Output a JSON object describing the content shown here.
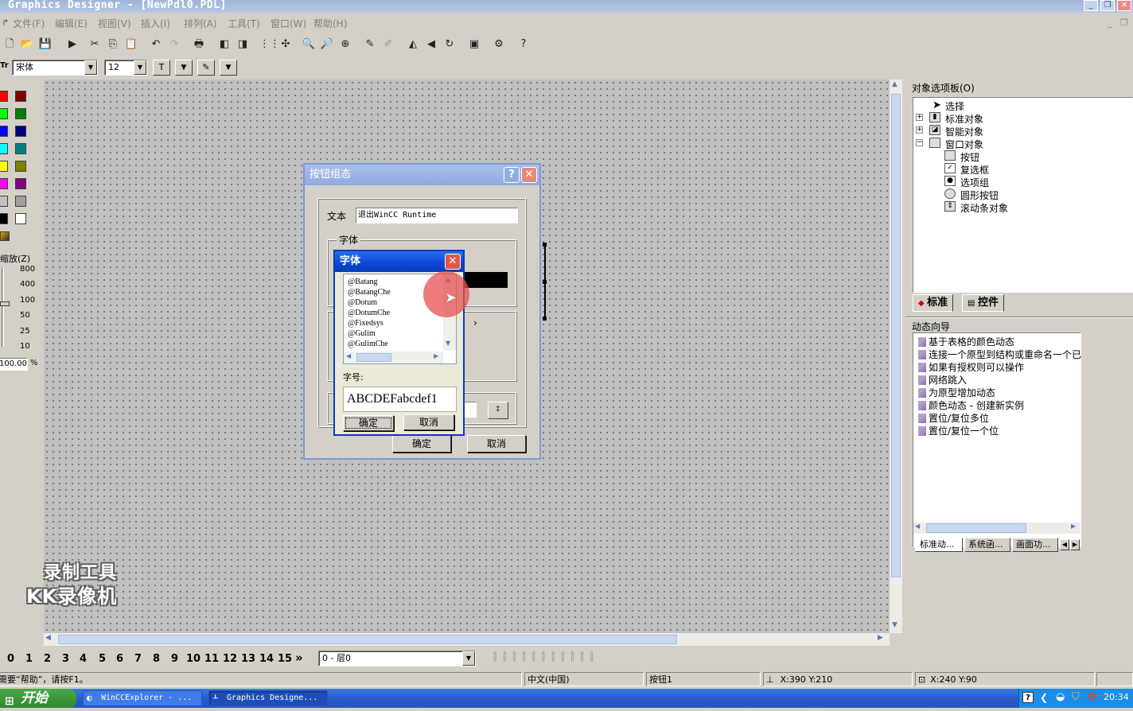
{
  "window": {
    "title": "Graphics Designer - [NewPdl0.PDL]"
  },
  "menu": [
    "文件(F)",
    "编辑(E)",
    "视图(V)",
    "插入(I)",
    "排列(A)",
    "工具(T)",
    "窗口(W)",
    "帮助(H)"
  ],
  "format_bar": {
    "font_name": "宋体",
    "font_size": "12"
  },
  "zoom": {
    "label": "缩放(Z)",
    "levels": [
      "800",
      "400",
      "100",
      "50",
      "25",
      "10"
    ],
    "value": "100.000",
    "unit": "%"
  },
  "dialog_button_config": {
    "title": "按钮组态",
    "text_label": "文本",
    "text_value": "退出WinCC Runtime",
    "font_group_label": "字体",
    "ok_label": "确定",
    "cancel_label": "取消"
  },
  "dialog_font": {
    "title": "字体",
    "fonts": [
      "@Batang",
      "@BatangChe",
      "@Dotum",
      "@DotumChe",
      "@Fixedsys",
      "@Gulim",
      "@GulimChe"
    ],
    "size_label": "字号:",
    "preview_text": "ABCDEFabcdef1",
    "ok_label": "确定",
    "cancel_label": "取消"
  },
  "object_palette": {
    "title": "对象选项板(O)",
    "items": [
      {
        "label": "选择",
        "level": 0,
        "icon": "pointer-icon"
      },
      {
        "label": "标准对象",
        "level": 0,
        "icon": "standard-objects-icon"
      },
      {
        "label": "智能对象",
        "level": 0,
        "icon": "smart-objects-icon"
      },
      {
        "label": "窗口对象",
        "level": 0,
        "icon": "window-objects-icon"
      },
      {
        "label": "按钮",
        "level": 1,
        "icon": "button-icon"
      },
      {
        "label": "复选框",
        "level": 1,
        "icon": "checkbox-icon"
      },
      {
        "label": "选项组",
        "level": 1,
        "icon": "radio-group-icon"
      },
      {
        "label": "圆形按钮",
        "level": 1,
        "icon": "round-button-icon"
      },
      {
        "label": "滚动条对象",
        "level": 1,
        "icon": "scrollbar-object-icon"
      }
    ],
    "tabs": [
      "标准",
      "控件"
    ]
  },
  "dynamic_wizard": {
    "title": "动态向导",
    "items": [
      "基于表格的颜色动态",
      "连接一个原型到结构或重命名一个已",
      "如果有授权则可以操作",
      "网络跳入",
      "为原型增加动态",
      "颜色动态 - 创建新实例",
      "置位/复位多位",
      "置位/复位一个位"
    ],
    "tabs": [
      "标准动...",
      "系统函...",
      "画面功..."
    ]
  },
  "layers": {
    "numbers": [
      "0",
      "1",
      "2",
      "3",
      "4",
      "5",
      "6",
      "7",
      "8",
      "9",
      "10",
      "11",
      "12",
      "13",
      "14",
      "15"
    ],
    "more": "»",
    "current": "0 - 层0"
  },
  "status": {
    "help": "需要“帮助”，请按F1。",
    "language": "中文(中国)",
    "object": "按钮1",
    "position": "X:390 Y:210",
    "size": "X:240 Y:90"
  },
  "taskbar": {
    "start": "开始",
    "tasks": [
      "WinCCExplorer - ...",
      "Graphics Designe..."
    ],
    "clock": "20:34"
  },
  "watermark": [
    "录制工具",
    "KK录像机"
  ],
  "colors": {
    "accent": "#0a3cb4",
    "canvas": "#c0c0c0",
    "taskbar": "#2a5cc8"
  }
}
